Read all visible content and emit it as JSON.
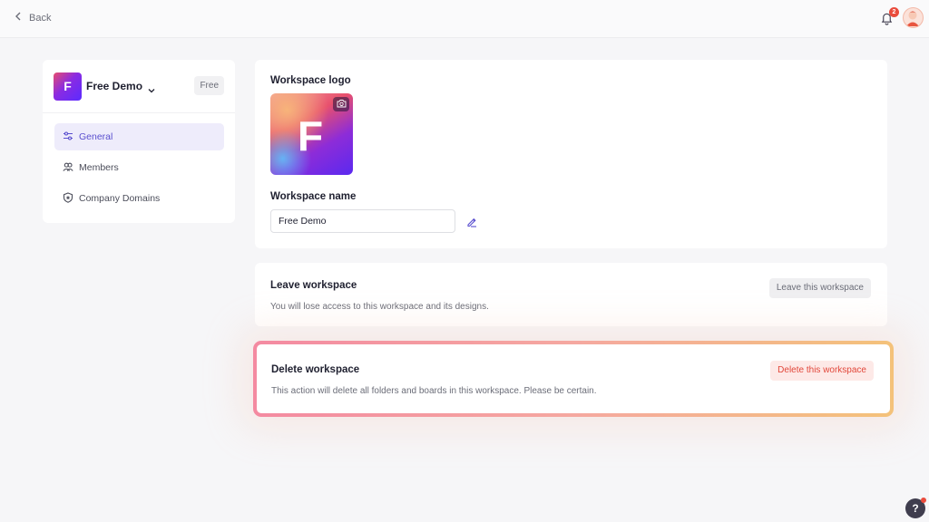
{
  "topbar": {
    "back_label": "Back",
    "notifications_count": "2",
    "icons": {
      "back": "chevron-left-icon",
      "bell": "bell-icon",
      "avatar": "user-avatar"
    }
  },
  "sidebar": {
    "workspace_initial": "F",
    "workspace_name": "Free Demo",
    "plan": "Free",
    "items": [
      {
        "label": "General",
        "icon": "sliders-icon",
        "active": true
      },
      {
        "label": "Members",
        "icon": "users-icon",
        "active": false
      },
      {
        "label": "Company Domains",
        "icon": "shield-star-icon",
        "active": false
      }
    ]
  },
  "general": {
    "logo_title": "Workspace logo",
    "logo_initial": "F",
    "name_title": "Workspace name",
    "name_value": "Free Demo"
  },
  "leave": {
    "title": "Leave workspace",
    "description": "You will lose access to this workspace and its designs.",
    "button": "Leave this workspace"
  },
  "delete": {
    "title": "Delete workspace",
    "description": "This action will delete all folders and boards in this workspace. Please be certain.",
    "button": "Delete this workspace"
  },
  "help": {
    "label": "?"
  },
  "colors": {
    "accent": "#5a4fcf",
    "danger": "#e2473a",
    "danger_bg": "#fde9e7",
    "background": "#f6f6f8"
  }
}
